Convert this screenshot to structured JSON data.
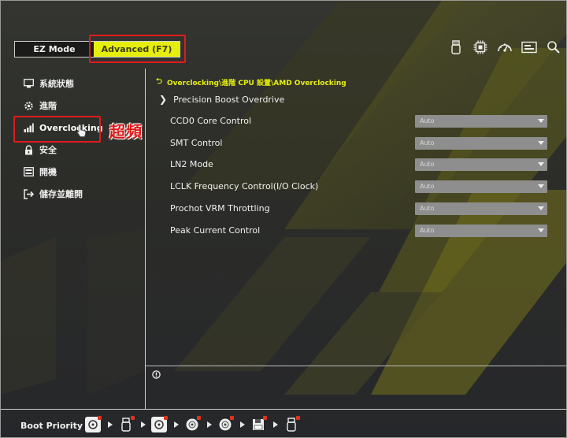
{
  "header": {
    "ez_mode_label": "EZ Mode",
    "advanced_label": "Advanced (F7)",
    "icons": [
      "usb-icon",
      "cpu-icon",
      "fan-speed-icon",
      "save-icon",
      "search-icon"
    ]
  },
  "sidebar": {
    "items": [
      {
        "label": "系統狀態",
        "icon": "monitor-icon"
      },
      {
        "label": "進階",
        "icon": "gear-icon"
      },
      {
        "label": "Overclocking",
        "icon": "bars-icon",
        "active": true
      },
      {
        "label": "安全",
        "icon": "lock-icon"
      },
      {
        "label": "開機",
        "icon": "boot-icon"
      },
      {
        "label": "儲存並離開",
        "icon": "exit-icon"
      }
    ],
    "annotation": "超頻"
  },
  "main": {
    "breadcrumb": "Overclocking\\進階 CPU 設置\\AMD Overclocking",
    "group_title": "Precision Boost Overdrive",
    "settings": [
      {
        "label": "CCD0 Core Control",
        "value": "Auto"
      },
      {
        "label": "SMT Control",
        "value": "Auto"
      },
      {
        "label": "LN2 Mode",
        "value": "Auto"
      },
      {
        "label": "LCLK Frequency Control(I/O Clock)",
        "value": "Auto"
      },
      {
        "label": "Prochot VRM Throttling",
        "value": "Auto"
      },
      {
        "label": "Peak Current Control",
        "value": "Auto"
      }
    ]
  },
  "footer": {
    "boot_label": "Boot Priority",
    "devices": [
      "hdd-icon",
      "usb-icon",
      "hdd-icon",
      "optical-disc-icon",
      "optical-disc-icon",
      "floppy-icon",
      "usb-icon"
    ]
  },
  "colors": {
    "accent": "#e6ee0e",
    "highlight": "#e11b1b",
    "background": "#2a2b27"
  }
}
